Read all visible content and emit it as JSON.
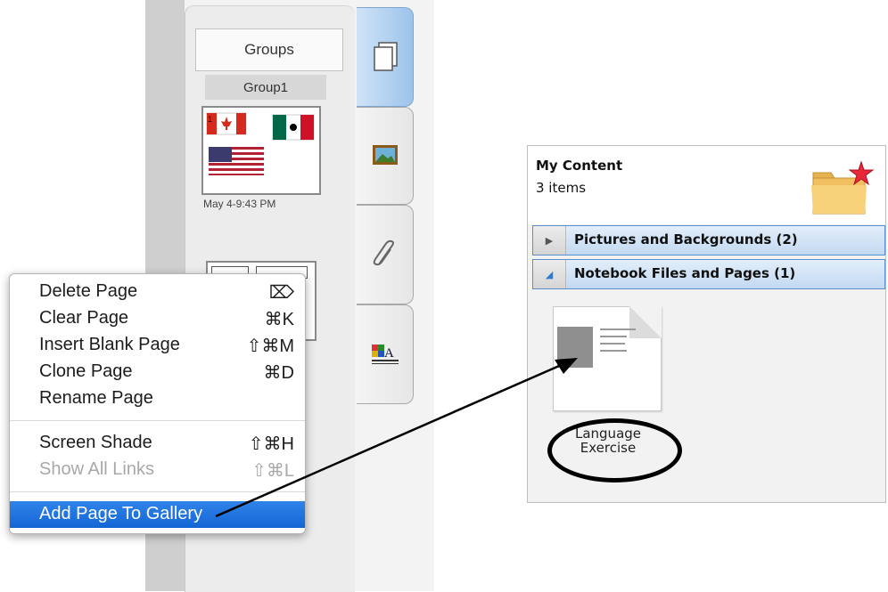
{
  "page_sorter": {
    "groups_button": "Groups",
    "group_name": "Group1",
    "thumbnails": [
      {
        "date": "May 4-9:43 PM"
      }
    ]
  },
  "side_tabs": [
    {
      "icon": "page-sorter-icon",
      "active": true
    },
    {
      "icon": "gallery-icon",
      "active": false
    },
    {
      "icon": "attachments-icon",
      "active": false
    },
    {
      "icon": "properties-icon",
      "active": false
    }
  ],
  "context_menu": {
    "items": [
      {
        "label": "Delete Page",
        "shortcut": "⌦",
        "enabled": true
      },
      {
        "label": "Clear Page",
        "shortcut": "⌘K",
        "enabled": true
      },
      {
        "label": "Insert Blank Page",
        "shortcut": "⇧⌘M",
        "enabled": true
      },
      {
        "label": "Clone Page",
        "shortcut": "⌘D",
        "enabled": true
      },
      {
        "label": "Rename Page",
        "shortcut": "",
        "enabled": true
      },
      {
        "label": "Screen Shade",
        "shortcut": "⇧⌘H",
        "enabled": true
      },
      {
        "label": "Show All Links",
        "shortcut": "⇧⌘L",
        "enabled": false
      },
      {
        "label": "Add Page To Gallery",
        "shortcut": "",
        "enabled": true,
        "highlighted": true
      }
    ]
  },
  "gallery": {
    "title": "My Content",
    "count": "3 items",
    "categories": [
      {
        "label": "Pictures and Backgrounds (2)",
        "expanded": false
      },
      {
        "label": "Notebook Files and Pages (1)",
        "expanded": true
      }
    ],
    "item": {
      "label_line1": "Language",
      "label_line2": "Exercise"
    }
  },
  "colors": {
    "menu_highlight": "#1466d6",
    "category_border": "#5a8fc9",
    "active_tab": "#9cc3ea"
  }
}
